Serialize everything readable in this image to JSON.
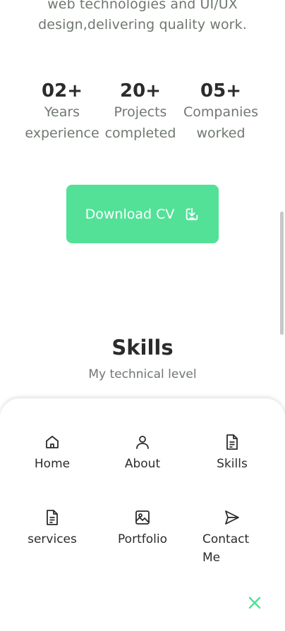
{
  "intro": {
    "line1": "web technologies and UI/UX",
    "line2": "design,delivering quality work."
  },
  "stats": [
    {
      "number": "02+",
      "label_line1": "Years",
      "label_line2": "experience"
    },
    {
      "number": "20+",
      "label_line1": "Projects",
      "label_line2": "completed"
    },
    {
      "number": "05+",
      "label_line1": "Companies",
      "label_line2": "worked"
    }
  ],
  "download_button": {
    "label": "Download CV",
    "icon": "download-icon"
  },
  "skills_section": {
    "title": "Skills",
    "subtitle": "My technical level"
  },
  "nav_menu": {
    "items": [
      {
        "label": "Home",
        "icon": "home-icon"
      },
      {
        "label": "About",
        "icon": "user-icon"
      },
      {
        "label": "Skills",
        "icon": "file-icon"
      },
      {
        "label": "services",
        "icon": "file-icon"
      },
      {
        "label": "Portfolio",
        "icon": "image-icon"
      },
      {
        "label_line1": "Contact",
        "label_line2": "Me",
        "icon": "send-icon"
      }
    ],
    "close_icon": "close-icon"
  },
  "colors": {
    "accent": "#53e197",
    "text_dark": "#2b2b2b",
    "text_muted": "#6f776f"
  }
}
